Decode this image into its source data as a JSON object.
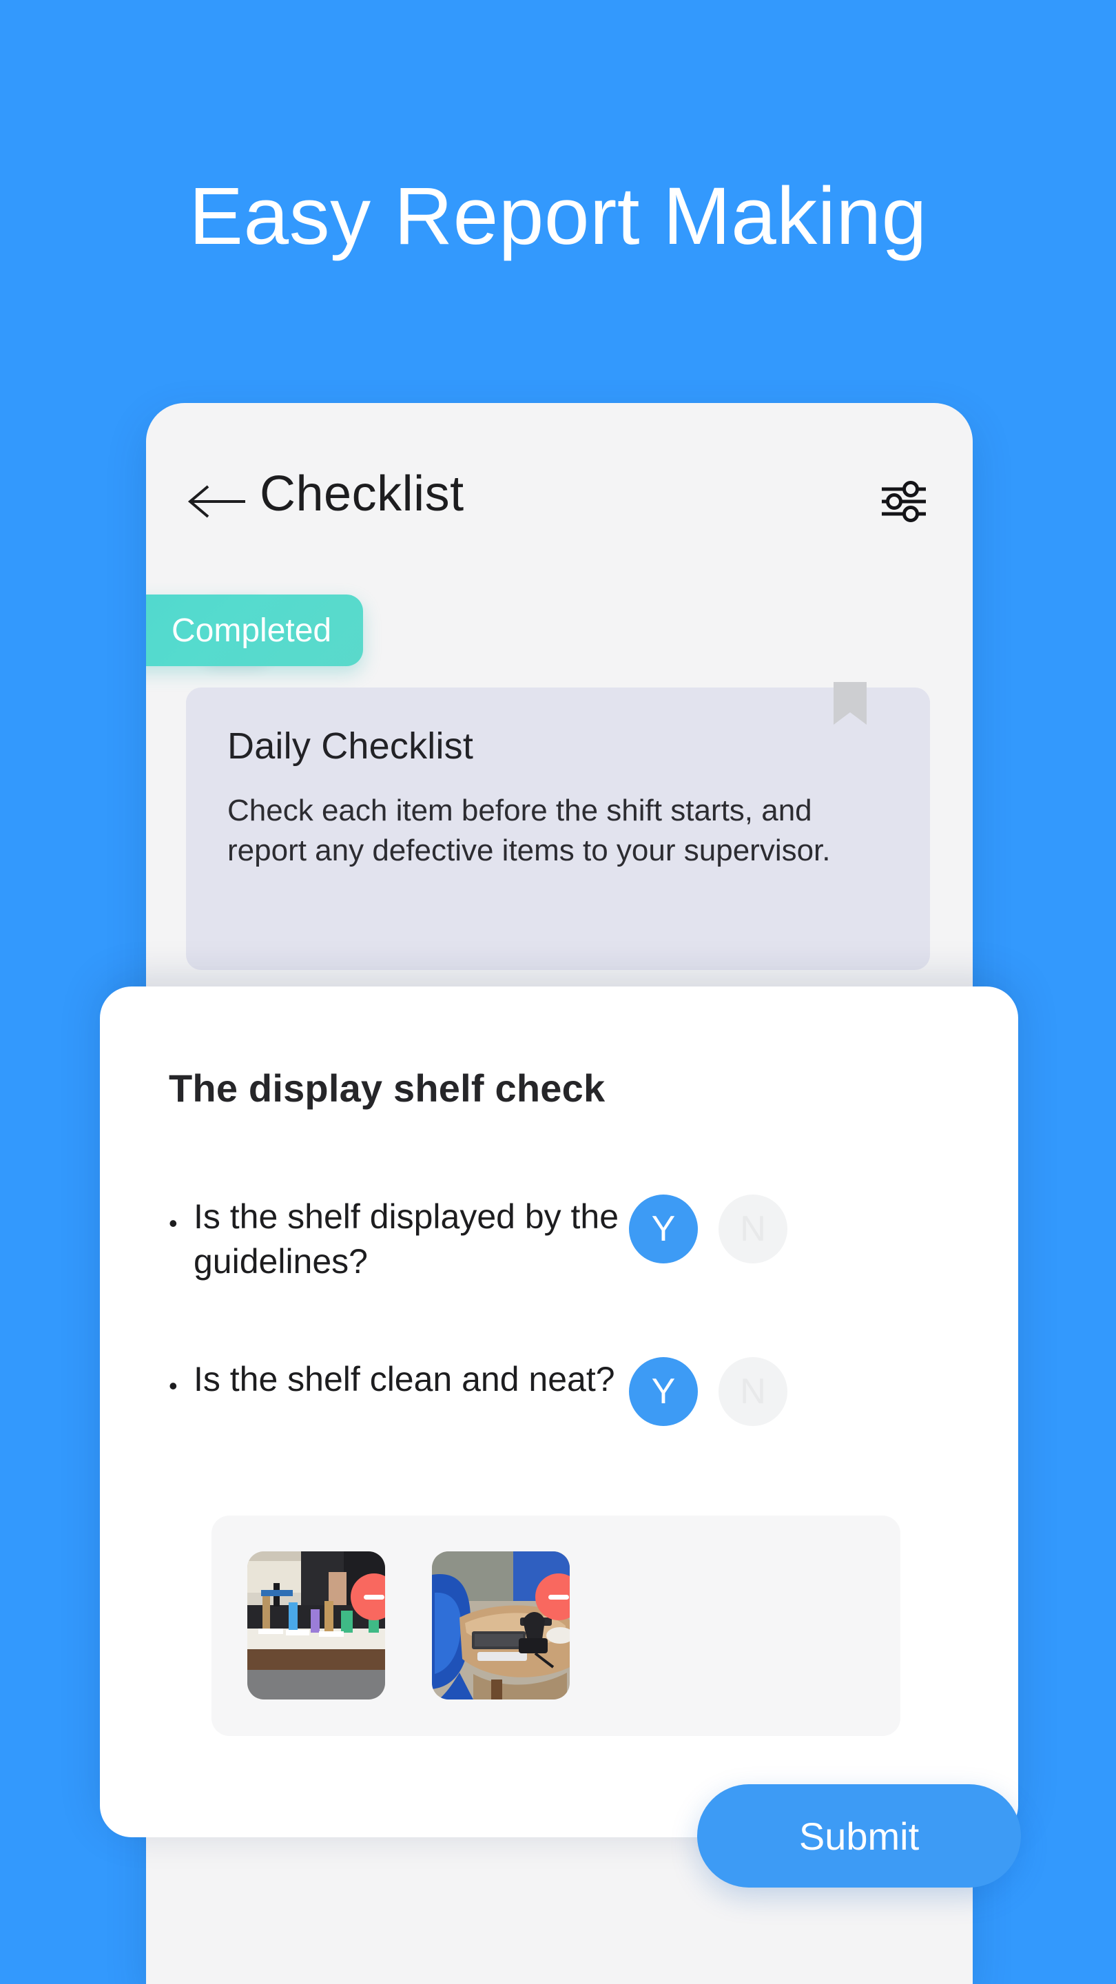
{
  "headline": "Easy Report Making",
  "colors": {
    "background_blue": "#3399fd",
    "accent_blue": "#3d9bf5",
    "chip_teal": "#55dbce",
    "remove_red": "#f9685f",
    "card_lavender": "#e2e3ee",
    "phone_surface": "#f4f4f5"
  },
  "app_bar": {
    "back_icon": "arrow-left-icon",
    "title": "Checklist",
    "filter_icon": "sliders-filter-icon"
  },
  "chip_row": {
    "status_label": "Completed",
    "edit_icon": "pencil-icon"
  },
  "daily_card": {
    "bookmark_icon": "bookmark-icon",
    "title": "Daily Checklist",
    "description": "Check each item before the shift starts, and report any defective items to your supervisor."
  },
  "sheet": {
    "title": "The display shelf check",
    "bullet": "•",
    "questions": [
      {
        "text": "Is the shelf displayed by the guidelines?",
        "yes_label": "Y",
        "no_label": "N",
        "selected": "Y"
      },
      {
        "text": "Is the shelf clean and neat?",
        "yes_label": "Y",
        "no_label": "N",
        "selected": "Y"
      }
    ],
    "photos": [
      {
        "alt": "retail phone display shelf photo",
        "remove_icon": "minus-circle-icon"
      },
      {
        "alt": "laptop on round table with blue chair photo",
        "remove_icon": "minus-circle-icon"
      }
    ]
  },
  "submit": {
    "label": "Submit"
  }
}
